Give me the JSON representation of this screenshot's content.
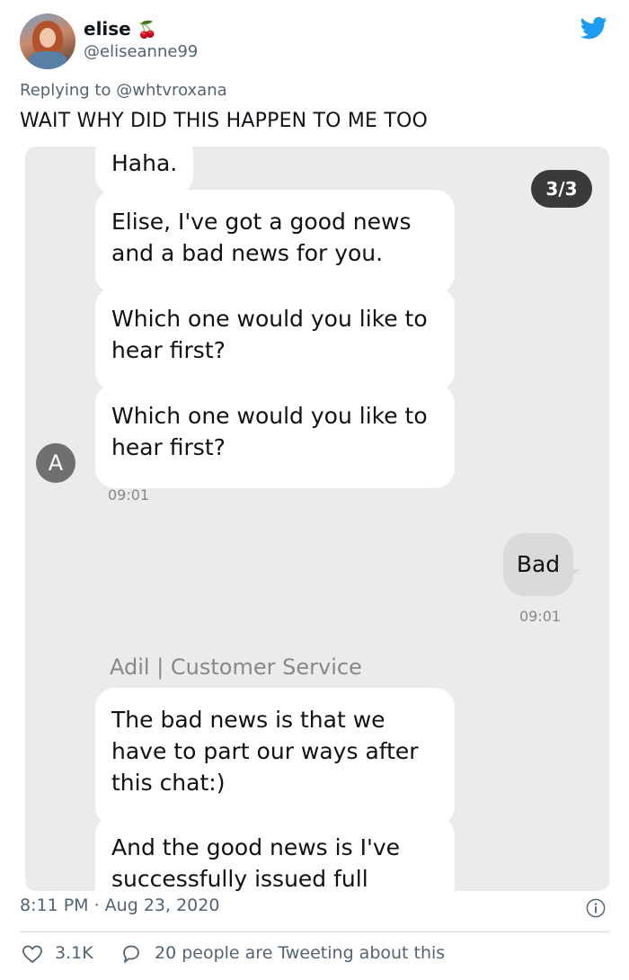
{
  "tweet": {
    "author_name": "elise",
    "author_emoji": "🍒",
    "handle": "@eliseanne99",
    "reply_prefix": "Replying to",
    "reply_to": "@whtvroxana",
    "text": "WAIT WHY DID THIS HAPPEN TO ME TOO",
    "timestamp": "8:11 PM · Aug 23, 2020",
    "likes": "3.1K",
    "talking": "20 people are Tweeting about this"
  },
  "chat": {
    "counter": "3/3",
    "messages": [
      {
        "text": "Haha."
      },
      {
        "text": "Elise, I've got a good news and a bad news for you."
      },
      {
        "text": "Which one would you like to hear first?"
      },
      {
        "text": "Which one would you like to hear first?"
      },
      {
        "text": "The bad news is that we have to part our ways after this chat:)"
      },
      {
        "text": "And the good news is I've successfully issued full refund"
      }
    ],
    "agent_initial": "A",
    "agent_time": "09:01",
    "user_message": "Bad",
    "user_time": "09:01",
    "agent_label": "Adil | Customer Service"
  },
  "colors": {
    "twitter_blue": "#1d9bf0",
    "chat_background": "#ebebeb",
    "muted_text": "#536471"
  }
}
